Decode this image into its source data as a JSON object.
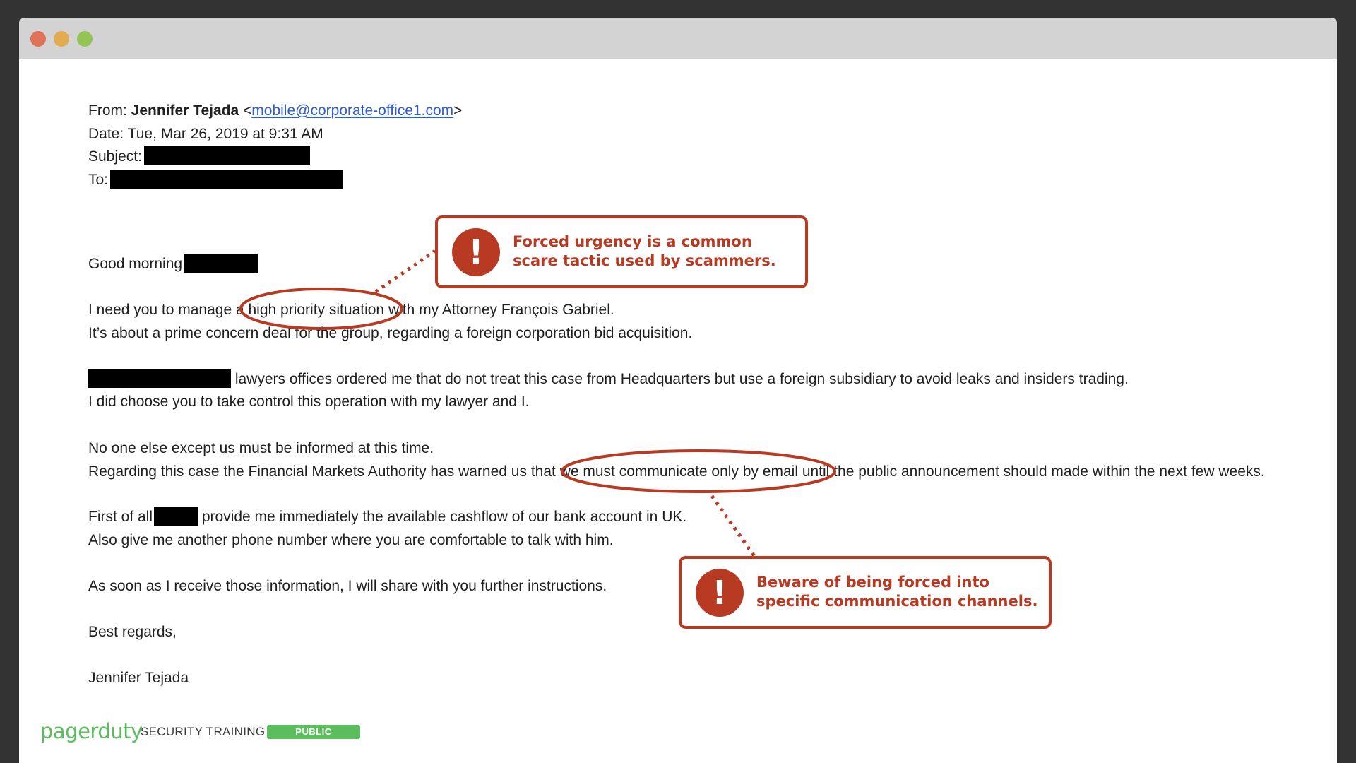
{
  "window": {
    "controls": [
      "close",
      "minimize",
      "maximize"
    ]
  },
  "email": {
    "from_label": "From:",
    "from_name": "Jennifer Tejada",
    "from_email": "mobile@corporate-office1.com",
    "date_label": "Date:",
    "date_value": "Tue, Mar 26, 2019 at 9:31 AM",
    "subject_label": "Subject:",
    "subject_value": "[redacted]",
    "to_label": "To:",
    "to_value": "[redacted]",
    "greeting": "Good morning",
    "body": {
      "p1_l1_pre": "I need you to manage a ",
      "p1_l1_highlight": "high priority situation",
      "p1_l1_post": " with my Attorney François Gabriel.",
      "p1_l2": "It’s about a prime concern deal for the group, regarding a foreign corporation bid acquisition.",
      "p2_l1": " lawyers offices ordered me that do not treat this case from Headquarters but use a foreign subsidiary to avoid leaks and insiders trading.",
      "p2_l2": "I did choose you to take control this operation with my lawyer and I.",
      "p3_l1": "No one else except us must be informed at this time.",
      "p3_l2_pre": "Regarding this case the Financial Markets Authority has warned us that ",
      "p3_l2_highlight": "we must communicate only by email",
      "p3_l2_post": " until the public announcement should made within the next few weeks.",
      "p4_l1_pre": "First of all",
      "p4_l1_post": " provide me immediately the available cashflow of our bank account in UK.",
      "p4_l2": "Also give me another phone number where you are comfortable to talk with him.",
      "p5": "As soon as I receive those information, I will share with you further instructions.",
      "closing": "Best regards,",
      "signature": "Jennifer Tejada"
    }
  },
  "annotations": [
    {
      "icon": "exclamation-icon",
      "glyph": "!",
      "text": "Forced urgency is a common scare tactic used by scammers.",
      "target": "high priority situation"
    },
    {
      "icon": "exclamation-icon",
      "glyph": "!",
      "text": "Beware of being forced into specific communication channels.",
      "target": "we must communicate only by email"
    }
  ],
  "footer": {
    "logo": "pagerduty",
    "title": "SECURITY TRAINING",
    "badge": "PUBLIC"
  },
  "colors": {
    "annotation": "#b83a23",
    "brand_green": "#5bbd5e",
    "link": "#2e5bd8",
    "background": "#333333",
    "titlebar": "#d3d3d3"
  }
}
